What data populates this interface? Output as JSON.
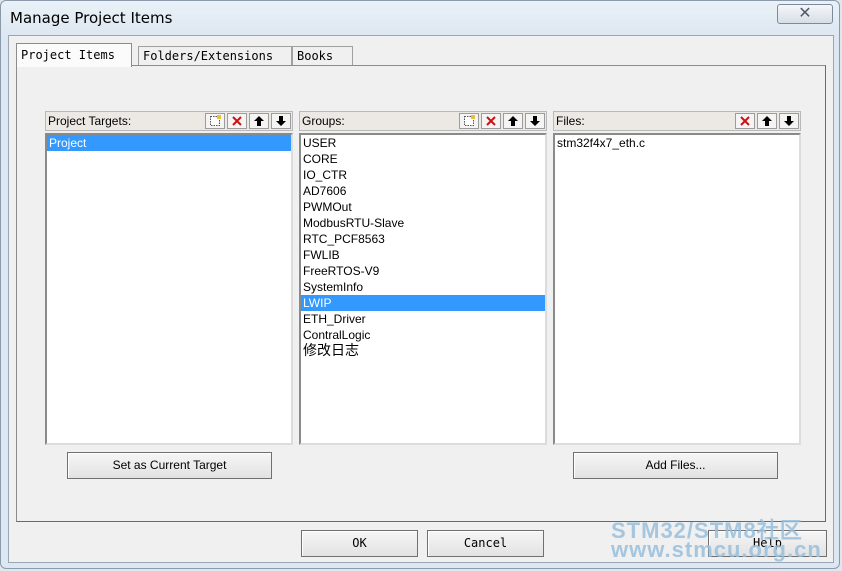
{
  "window": {
    "title": "Manage Project Items",
    "close_glyph": "✕"
  },
  "tabs": [
    {
      "label": "Project Items",
      "active": true
    },
    {
      "label": "Folders/Extensions",
      "active": false
    },
    {
      "label": "Books",
      "active": false
    }
  ],
  "targets": {
    "label": "Project Targets:",
    "items": [
      "Project"
    ],
    "selected": "Project",
    "tools": [
      "new-icon",
      "delete-icon",
      "move-up-icon",
      "move-down-icon"
    ],
    "button_label": "Set as Current Target"
  },
  "groups": {
    "label": "Groups:",
    "items": [
      "USER",
      "CORE",
      "IO_CTR",
      "AD7606",
      "PWMOut",
      "ModbusRTU-Slave",
      "RTC_PCF8563",
      "FWLIB",
      "FreeRTOS-V9",
      "SystemInfo",
      "LWIP",
      "ETH_Driver",
      "ContralLogic",
      "修改日志"
    ],
    "selected": "LWIP",
    "tools": [
      "new-icon",
      "delete-icon",
      "move-up-icon",
      "move-down-icon"
    ]
  },
  "files": {
    "label": "Files:",
    "items": [
      "stm32f4x7_eth.c"
    ],
    "tools": [
      "delete-icon",
      "move-up-icon",
      "move-down-icon"
    ],
    "button_label": "Add Files..."
  },
  "footer": {
    "ok_label": "OK",
    "cancel_label": "Cancel",
    "help_label": "Help"
  },
  "watermark": {
    "line1": "STM32/STM8社区",
    "line2": "www.stmcu.org.cn"
  },
  "colors": {
    "selection": "#3399ff",
    "delete_icon": "#cc1111"
  }
}
